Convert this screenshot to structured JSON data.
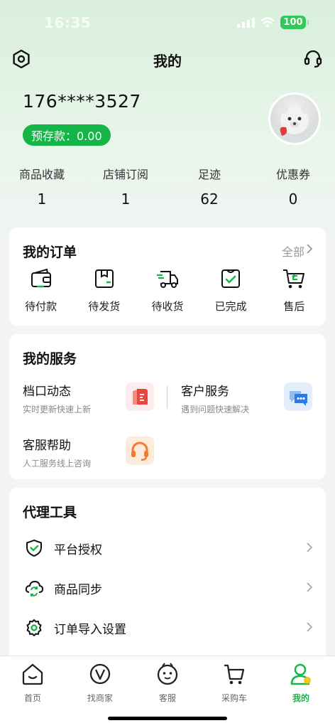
{
  "status_bar": {
    "time": "16:35",
    "battery": "100"
  },
  "header": {
    "title": "我的"
  },
  "profile": {
    "phone": "176****3527",
    "deposit": "预存款：0.00"
  },
  "stats": [
    {
      "label": "商品收藏",
      "value": "1"
    },
    {
      "label": "店铺订阅",
      "value": "1"
    },
    {
      "label": "足迹",
      "value": "62"
    },
    {
      "label": "优惠券",
      "value": "0"
    }
  ],
  "orders": {
    "title": "我的订单",
    "see_all": "全部",
    "tabs": [
      {
        "label": "待付款",
        "icon": "wallet-icon"
      },
      {
        "label": "待发货",
        "icon": "package-icon"
      },
      {
        "label": "待收货",
        "icon": "delivery-truck-icon"
      },
      {
        "label": "已完成",
        "icon": "completed-bag-icon"
      },
      {
        "label": "售后",
        "icon": "after-sale-cart-icon"
      }
    ]
  },
  "services": {
    "title": "我的服务",
    "items": [
      {
        "title": "档口动态",
        "subtitle": "实时更新快速上新",
        "icon": "stall-news-icon"
      },
      {
        "title": "客户服务",
        "subtitle": "遇到问题快速解决",
        "icon": "chat-bubbles-icon"
      },
      {
        "title": "客服帮助",
        "subtitle": "人工服务线上咨询",
        "icon": "headset-icon"
      }
    ]
  },
  "tools": {
    "title": "代理工具",
    "items": [
      {
        "label": "平台授权",
        "icon": "shield-check-icon"
      },
      {
        "label": "商品同步",
        "icon": "sync-cloud-icon"
      },
      {
        "label": "订单导入设置",
        "icon": "gear-icon"
      }
    ]
  },
  "tab_bar": [
    {
      "label": "首页",
      "icon": "home-icon"
    },
    {
      "label": "找商家",
      "icon": "find-merchant-icon"
    },
    {
      "label": "客服",
      "icon": "customer-service-face-icon"
    },
    {
      "label": "采购车",
      "icon": "shopping-cart-icon"
    },
    {
      "label": "我的",
      "icon": "user-icon",
      "active": true
    }
  ],
  "colors": {
    "accent": "#16b548",
    "background": "#f3f4f6",
    "card": "#ffffff"
  }
}
